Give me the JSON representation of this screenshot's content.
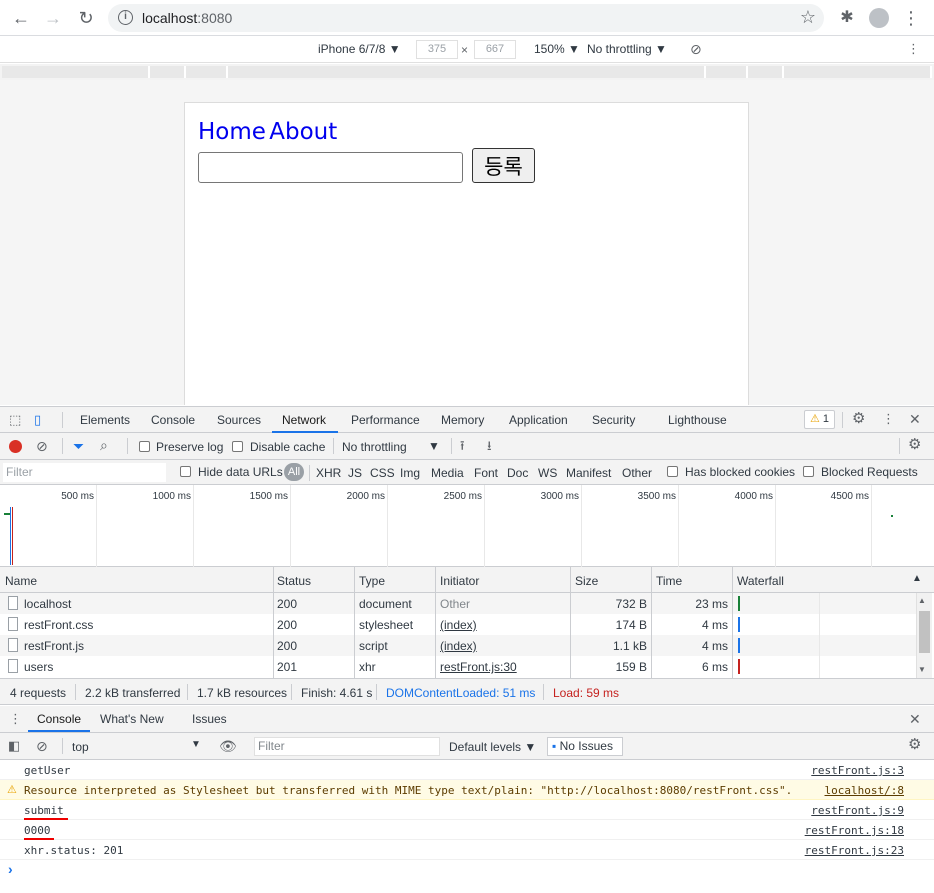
{
  "browser": {
    "url_host": "localhost",
    "url_port": ":8080"
  },
  "device_toolbar": {
    "device": "iPhone 6/7/8 ▼",
    "width": "375",
    "times": "×",
    "height": "667",
    "zoom": "150% ▼",
    "throttling": "No throttling ▼"
  },
  "page": {
    "nav_home": "Home",
    "nav_about": "About",
    "input_value": "",
    "submit_label": "등록"
  },
  "devtools": {
    "tabs": [
      "Elements",
      "Console",
      "Sources",
      "Network",
      "Performance",
      "Memory",
      "Application",
      "Security",
      "Lighthouse"
    ],
    "active_tab": "Network",
    "warning_count": "1",
    "net_toolbar": {
      "preserve_log": "Preserve log",
      "disable_cache": "Disable cache",
      "throttling": "No throttling"
    },
    "filter": {
      "placeholder": "Filter",
      "hide_data_urls": "Hide data URLs",
      "all": "All",
      "types": [
        "XHR",
        "JS",
        "CSS",
        "Img",
        "Media",
        "Font",
        "Doc",
        "WS",
        "Manifest",
        "Other"
      ],
      "has_blocked_cookies": "Has blocked cookies",
      "blocked_requests": "Blocked Requests"
    },
    "overview_ticks": [
      "500 ms",
      "1000 ms",
      "1500 ms",
      "2000 ms",
      "2500 ms",
      "3000 ms",
      "3500 ms",
      "4000 ms",
      "4500 ms"
    ],
    "table": {
      "headers": [
        "Name",
        "Status",
        "Type",
        "Initiator",
        "Size",
        "Time",
        "Waterfall"
      ],
      "rows": [
        {
          "name": "localhost",
          "status": "200",
          "type": "document",
          "initiator": "Other",
          "size": "732 B",
          "time": "23 ms"
        },
        {
          "name": "restFront.css",
          "status": "200",
          "type": "stylesheet",
          "initiator": "(index)",
          "size": "174 B",
          "time": "4 ms"
        },
        {
          "name": "restFront.js",
          "status": "200",
          "type": "script",
          "initiator": "(index)",
          "size": "1.1 kB",
          "time": "4 ms"
        },
        {
          "name": "users",
          "status": "201",
          "type": "xhr",
          "initiator": "restFront.js:30",
          "size": "159 B",
          "time": "6 ms"
        }
      ]
    },
    "summary": {
      "requests": "4 requests",
      "transferred": "2.2 kB transferred",
      "resources": "1.7 kB resources",
      "finish": "Finish: 4.61 s",
      "dom_loaded": "DOMContentLoaded: 51 ms",
      "load": "Load: 59 ms"
    },
    "drawer_tabs": [
      "Console",
      "What's New",
      "Issues"
    ],
    "console_toolbar": {
      "context": "top",
      "filter_placeholder": "Filter",
      "levels": "Default levels ▼",
      "issues": "No Issues"
    },
    "console_lines": [
      {
        "msg": "getUser",
        "src": "restFront.js:3"
      },
      {
        "msg": "Resource interpreted as Stylesheet but transferred with MIME type text/plain: \"http://localhost:8080/restFront.css\".",
        "src": "localhost/:8"
      },
      {
        "msg": "submit",
        "src": "restFront.js:9"
      },
      {
        "msg": "0000",
        "src": "restFront.js:18"
      },
      {
        "msg": "xhr.status: 201",
        "src": "restFront.js:23"
      }
    ],
    "prompt": "›"
  },
  "colors": {
    "accent": "#1a73e8",
    "dom_loaded": "#1a73e8",
    "load": "#c5221f",
    "link": "#0000ee",
    "annotation": "#e00000"
  }
}
